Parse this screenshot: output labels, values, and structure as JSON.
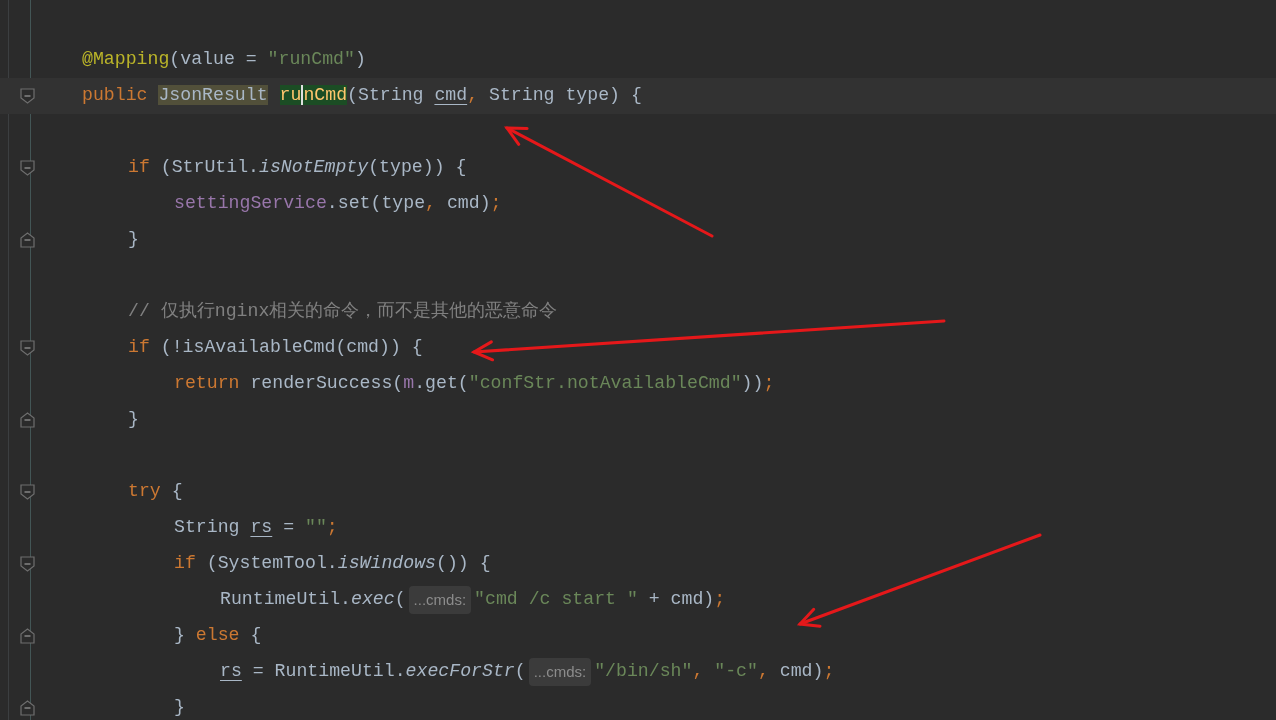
{
  "editor": {
    "lines": [
      {
        "kind": "code",
        "current": false,
        "fold_start": false,
        "fold_end": false,
        "tokens": [
          {
            "text": "@Mapping",
            "kind": "annotation"
          },
          {
            "text": "(value = ",
            "kind": "plain"
          },
          {
            "text": "\"runCmd\"",
            "kind": "string"
          },
          {
            "text": ")",
            "kind": "plain"
          }
        ]
      },
      {
        "kind": "code",
        "current": true,
        "fold_start": true,
        "fold_end": false,
        "tokens": [
          {
            "text": "public ",
            "kind": "keyword"
          },
          {
            "text": "JsonResult",
            "kind": "type-highlight"
          },
          {
            "text": "ru",
            "kind": "usage-highlight",
            "caret": true
          },
          {
            "text": "nCmd",
            "kind": "usage-highlight"
          },
          {
            "text": "(String ",
            "kind": "plain"
          },
          {
            "text": "cmd",
            "kind": "underlined"
          },
          {
            "text": ",",
            "kind": "punct"
          },
          {
            "text": " String type) {",
            "kind": "plain"
          }
        ],
        "children": [
          {
            "kind": "blank",
            "current": false,
            "fold_start": false,
            "fold_end": false
          },
          {
            "kind": "code",
            "current": false,
            "fold_start": true,
            "fold_end": false,
            "tokens": [
              {
                "text": "if ",
                "kind": "keyword"
              },
              {
                "text": "(StrUtil.",
                "kind": "plain"
              },
              {
                "text": "isNotEmpty",
                "kind": "static"
              },
              {
                "text": "(type)) {",
                "kind": "plain"
              }
            ],
            "children": [
              {
                "kind": "code",
                "current": false,
                "fold_start": false,
                "fold_end": false,
                "tokens": [
                  {
                    "text": "settingService",
                    "kind": "field"
                  },
                  {
                    "text": ".set(type",
                    "kind": "plain"
                  },
                  {
                    "text": ",",
                    "kind": "punct"
                  },
                  {
                    "text": " cmd)",
                    "kind": "plain"
                  },
                  {
                    "text": ";",
                    "kind": "punct"
                  }
                ]
              }
            ]
          },
          {
            "kind": "code",
            "current": false,
            "fold_start": false,
            "fold_end": true,
            "tokens": [
              {
                "text": "}",
                "kind": "plain"
              }
            ]
          },
          {
            "kind": "blank",
            "current": false,
            "fold_start": false,
            "fold_end": false
          },
          {
            "kind": "code",
            "current": false,
            "fold_start": false,
            "fold_end": false,
            "tokens": [
              {
                "text": "// 仅执行nginx相关的命令，而不是其他的恶意命令",
                "kind": "comment"
              }
            ]
          },
          {
            "kind": "code",
            "current": false,
            "fold_start": true,
            "fold_end": false,
            "tokens": [
              {
                "text": "if ",
                "kind": "keyword"
              },
              {
                "text": "(!isAvailableCmd(cmd)) {",
                "kind": "plain"
              }
            ],
            "children": [
              {
                "kind": "code",
                "current": false,
                "fold_start": false,
                "fold_end": false,
                "tokens": [
                  {
                    "text": "return ",
                    "kind": "keyword"
                  },
                  {
                    "text": "renderSuccess(",
                    "kind": "plain"
                  },
                  {
                    "text": "m",
                    "kind": "field"
                  },
                  {
                    "text": ".get(",
                    "kind": "plain"
                  },
                  {
                    "text": "\"confStr.notAvailableCmd\"",
                    "kind": "string"
                  },
                  {
                    "text": "))",
                    "kind": "plain"
                  },
                  {
                    "text": ";",
                    "kind": "punct"
                  }
                ]
              }
            ]
          },
          {
            "kind": "code",
            "current": false,
            "fold_start": false,
            "fold_end": true,
            "tokens": [
              {
                "text": "}",
                "kind": "plain"
              }
            ]
          },
          {
            "kind": "blank",
            "current": false,
            "fold_start": false,
            "fold_end": false
          },
          {
            "kind": "code",
            "current": false,
            "fold_start": true,
            "fold_end": false,
            "tokens": [
              {
                "text": "try ",
                "kind": "keyword"
              },
              {
                "text": "{",
                "kind": "plain"
              }
            ],
            "children": [
              {
                "kind": "code",
                "current": false,
                "fold_start": false,
                "fold_end": false,
                "tokens": [
                  {
                    "text": "String ",
                    "kind": "plain"
                  },
                  {
                    "text": "rs",
                    "kind": "underlined"
                  },
                  {
                    "text": " = ",
                    "kind": "plain"
                  },
                  {
                    "text": "\"\"",
                    "kind": "string"
                  },
                  {
                    "text": ";",
                    "kind": "punct"
                  }
                ]
              },
              {
                "kind": "code",
                "current": false,
                "fold_start": true,
                "fold_end": false,
                "tokens": [
                  {
                    "text": "if ",
                    "kind": "keyword"
                  },
                  {
                    "text": "(SystemTool.",
                    "kind": "plain"
                  },
                  {
                    "text": "isWindows",
                    "kind": "static"
                  },
                  {
                    "text": "()) {",
                    "kind": "plain"
                  }
                ],
                "children": [
                  {
                    "kind": "code",
                    "current": false,
                    "fold_start": false,
                    "fold_end": false,
                    "tokens": [
                      {
                        "text": "RuntimeUtil.",
                        "kind": "plain"
                      },
                      {
                        "text": "exec",
                        "kind": "static"
                      },
                      {
                        "text": "(",
                        "kind": "plain"
                      },
                      {
                        "text": "...cmds:",
                        "kind": "hint"
                      },
                      {
                        "text": "\"cmd /c start \"",
                        "kind": "string"
                      },
                      {
                        "text": " + cmd)",
                        "kind": "plain"
                      },
                      {
                        "text": ";",
                        "kind": "punct"
                      }
                    ]
                  }
                ]
              },
              {
                "kind": "code",
                "current": false,
                "fold_start": false,
                "fold_end": true,
                "tokens": [
                  {
                    "text": "} ",
                    "kind": "plain"
                  },
                  {
                    "text": "else ",
                    "kind": "keyword"
                  },
                  {
                    "text": "{",
                    "kind": "plain"
                  }
                ],
                "children": [
                  {
                    "kind": "code",
                    "current": false,
                    "fold_start": false,
                    "fold_end": false,
                    "tokens": [
                      {
                        "text": "rs",
                        "kind": "underlined"
                      },
                      {
                        "text": " = RuntimeUtil.",
                        "kind": "plain"
                      },
                      {
                        "text": "execForStr",
                        "kind": "static"
                      },
                      {
                        "text": "(",
                        "kind": "plain"
                      },
                      {
                        "text": "...cmds:",
                        "kind": "hint"
                      },
                      {
                        "text": "\"/bin/sh\"",
                        "kind": "string"
                      },
                      {
                        "text": ", ",
                        "kind": "punct"
                      },
                      {
                        "text": "\"-c\"",
                        "kind": "string"
                      },
                      {
                        "text": ",",
                        "kind": "punct"
                      },
                      {
                        "text": " cmd)",
                        "kind": "plain"
                      },
                      {
                        "text": ";",
                        "kind": "punct"
                      }
                    ]
                  }
                ]
              },
              {
                "kind": "code",
                "current": false,
                "fold_start": false,
                "fold_end": true,
                "tokens": [
                  {
                    "text": "}",
                    "kind": "plain"
                  }
                ]
              }
            ]
          }
        ]
      }
    ]
  }
}
